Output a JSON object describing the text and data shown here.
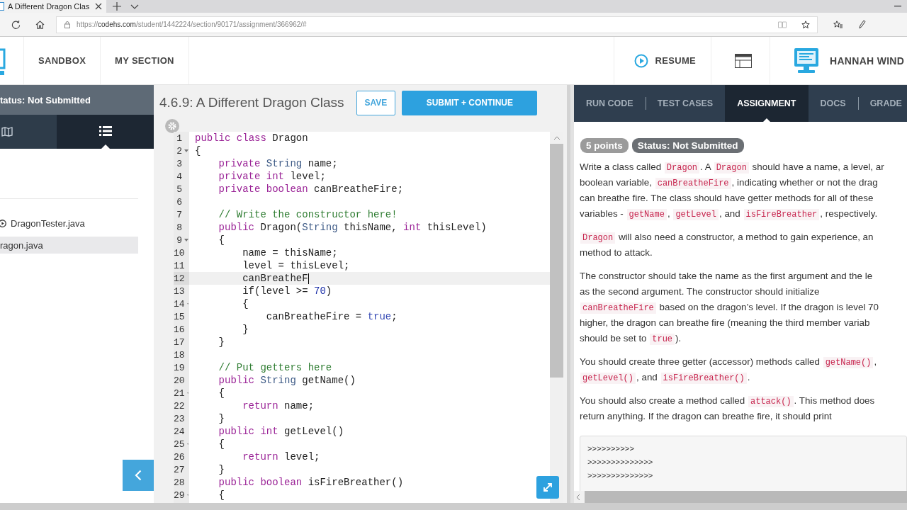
{
  "browser": {
    "tab_title": "A Different Dragon Clas",
    "url": {
      "scheme": "https://",
      "host": "codehs.com",
      "path": "/student/1442224/section/90171/assignment/366962/#"
    }
  },
  "header": {
    "nav": [
      {
        "label": "SANDBOX"
      },
      {
        "label": "MY SECTION"
      }
    ],
    "resume": "RESUME",
    "user": "HANNAH WIND"
  },
  "sidebar": {
    "status": "tatus: Not Submitted",
    "views": [
      {
        "kind": "map",
        "selected": false
      },
      {
        "kind": "list",
        "selected": true
      }
    ],
    "files": [
      {
        "name": "DragonTester.java",
        "kind": "runnable",
        "selected": false
      },
      {
        "name": "ragon.java",
        "kind": "plain",
        "selected": true
      }
    ]
  },
  "editor": {
    "title": "4.6.9: A Different Dragon Class",
    "save": "SAVE",
    "submit": "SUBMIT + CONTINUE",
    "lines": [
      {
        "number": "1",
        "fold": false,
        "active": false,
        "tokens": [
          {
            "kind": "keyword",
            "text": "public"
          },
          {
            "kind": "keyword",
            "text": " class"
          },
          {
            "kind": "plain",
            "text": " Dragon"
          }
        ]
      },
      {
        "number": "2",
        "fold": true,
        "active": false,
        "tokens": [
          {
            "kind": "plain",
            "text": "{"
          }
        ]
      },
      {
        "number": "3",
        "fold": false,
        "active": false,
        "tokens": [
          {
            "kind": "keyword",
            "text": "    private"
          },
          {
            "kind": "type",
            "text": " String"
          },
          {
            "kind": "plain",
            "text": " name;"
          }
        ]
      },
      {
        "number": "4",
        "fold": false,
        "active": false,
        "tokens": [
          {
            "kind": "keyword",
            "text": "    private int"
          },
          {
            "kind": "plain",
            "text": " level;"
          }
        ]
      },
      {
        "number": "5",
        "fold": false,
        "active": false,
        "tokens": [
          {
            "kind": "keyword",
            "text": "    private boolean"
          },
          {
            "kind": "plain",
            "text": " canBreatheFire;"
          }
        ]
      },
      {
        "number": "6",
        "fold": false,
        "active": false
      },
      {
        "number": "7",
        "fold": false,
        "active": false,
        "tokens": [
          {
            "kind": "comment",
            "text": "    // Write the constructor here!"
          }
        ]
      },
      {
        "number": "8",
        "fold": false,
        "active": false,
        "tokens": [
          {
            "kind": "keyword",
            "text": "    public"
          },
          {
            "kind": "plain",
            "text": " Dragon("
          },
          {
            "kind": "type",
            "text": "String"
          },
          {
            "kind": "plain",
            "text": " thisName, "
          },
          {
            "kind": "keyword",
            "text": "int"
          },
          {
            "kind": "plain",
            "text": " thisLevel)"
          }
        ]
      },
      {
        "number": "9",
        "fold": true,
        "active": false,
        "tokens": [
          {
            "kind": "plain",
            "text": "    {"
          }
        ]
      },
      {
        "number": "10",
        "fold": false,
        "active": false,
        "tokens": [
          {
            "kind": "plain",
            "text": "        name = thisName;"
          }
        ]
      },
      {
        "number": "11",
        "fold": false,
        "active": false,
        "tokens": [
          {
            "kind": "plain",
            "text": "        level = thisLevel;"
          }
        ]
      },
      {
        "number": "12",
        "fold": false,
        "active": true,
        "tokens": [
          {
            "kind": "plain",
            "text": "        canBreatheF"
          }
        ]
      },
      {
        "number": "13",
        "fold": false,
        "active": false,
        "tokens": [
          {
            "kind": "plain",
            "text": "        if(level >= "
          },
          {
            "kind": "number",
            "text": "70"
          },
          {
            "kind": "plain",
            "text": ")"
          }
        ]
      },
      {
        "number": "14",
        "fold": true,
        "active": false,
        "tokens": [
          {
            "kind": "plain",
            "text": "        {"
          }
        ]
      },
      {
        "number": "15",
        "fold": false,
        "active": false,
        "tokens": [
          {
            "kind": "plain",
            "text": "            canBreatheFire = "
          },
          {
            "kind": "literal",
            "text": "true"
          },
          {
            "kind": "plain",
            "text": ";"
          }
        ]
      },
      {
        "number": "16",
        "fold": false,
        "active": false,
        "tokens": [
          {
            "kind": "plain",
            "text": "        }"
          }
        ]
      },
      {
        "number": "17",
        "fold": false,
        "active": false,
        "tokens": [
          {
            "kind": "plain",
            "text": "    }"
          }
        ]
      },
      {
        "number": "18",
        "fold": false,
        "active": false
      },
      {
        "number": "19",
        "fold": false,
        "active": false,
        "tokens": [
          {
            "kind": "comment",
            "text": "    // Put getters here"
          }
        ]
      },
      {
        "number": "20",
        "fold": false,
        "active": false,
        "tokens": [
          {
            "kind": "keyword",
            "text": "    public"
          },
          {
            "kind": "type",
            "text": " String"
          },
          {
            "kind": "plain",
            "text": " getName()"
          }
        ]
      },
      {
        "number": "21",
        "fold": true,
        "active": false,
        "tokens": [
          {
            "kind": "plain",
            "text": "    {"
          }
        ]
      },
      {
        "number": "22",
        "fold": false,
        "active": false,
        "tokens": [
          {
            "kind": "keyword",
            "text": "        return"
          },
          {
            "kind": "plain",
            "text": " name;"
          }
        ]
      },
      {
        "number": "23",
        "fold": false,
        "active": false,
        "tokens": [
          {
            "kind": "plain",
            "text": "    }"
          }
        ]
      },
      {
        "number": "24",
        "fold": false,
        "active": false,
        "tokens": [
          {
            "kind": "keyword",
            "text": "    public int"
          },
          {
            "kind": "plain",
            "text": " getLevel()"
          }
        ]
      },
      {
        "number": "25",
        "fold": true,
        "active": false,
        "tokens": [
          {
            "kind": "plain",
            "text": "    {"
          }
        ]
      },
      {
        "number": "26",
        "fold": false,
        "active": false,
        "tokens": [
          {
            "kind": "keyword",
            "text": "        return"
          },
          {
            "kind": "plain",
            "text": " level;"
          }
        ]
      },
      {
        "number": "27",
        "fold": false,
        "active": false,
        "tokens": [
          {
            "kind": "plain",
            "text": "    }"
          }
        ]
      },
      {
        "number": "28",
        "fold": false,
        "active": false,
        "tokens": [
          {
            "kind": "keyword",
            "text": "    public boolean"
          },
          {
            "kind": "plain",
            "text": " isFireBreather()"
          }
        ]
      },
      {
        "number": "29",
        "fold": true,
        "active": false,
        "tokens": [
          {
            "kind": "plain",
            "text": "    {"
          }
        ]
      }
    ]
  },
  "panel": {
    "tabs": [
      {
        "label": "RUN CODE",
        "selected": false
      },
      {
        "label": "TEST CASES",
        "selected": false
      },
      {
        "label": "ASSIGNMENT",
        "selected": true
      },
      {
        "label": "DOCS",
        "selected": false
      },
      {
        "label": "GRADE",
        "selected": false
      }
    ],
    "badges": [
      {
        "text": "5 points",
        "color": "#9b9b9b"
      },
      {
        "text": "Status: Not Submitted",
        "color": "#6b6f74"
      }
    ],
    "paragraphs": [
      {
        "lines": [
          [
            {
              "kind": "text",
              "text": "Write a class called "
            },
            {
              "kind": "code",
              "text": "Dragon"
            },
            {
              "kind": "text",
              "text": ". A "
            },
            {
              "kind": "code",
              "text": "Dragon"
            },
            {
              "kind": "text",
              "text": " should have a name, a level, ar"
            }
          ],
          [
            {
              "kind": "text",
              "text": "boolean variable, "
            },
            {
              "kind": "code",
              "text": "canBreatheFire"
            },
            {
              "kind": "text",
              "text": ", indicating whether or not the drag"
            }
          ],
          [
            {
              "kind": "text",
              "text": "can breathe fire. The class should have getter methods for all of these"
            }
          ],
          [
            {
              "kind": "text",
              "text": "variables - "
            },
            {
              "kind": "code",
              "text": "getName"
            },
            {
              "kind": "text",
              "text": ", "
            },
            {
              "kind": "code",
              "text": "getLevel"
            },
            {
              "kind": "text",
              "text": ", and "
            },
            {
              "kind": "code",
              "text": "isFireBreather"
            },
            {
              "kind": "text",
              "text": ", respectively."
            }
          ]
        ]
      },
      {
        "lines": [
          [
            {
              "kind": "code",
              "text": "Dragon"
            },
            {
              "kind": "text",
              "text": " will also need a constructor, a method to gain experience, an"
            }
          ],
          [
            {
              "kind": "text",
              "text": "method to attack."
            }
          ]
        ]
      },
      {
        "lines": [
          [
            {
              "kind": "text",
              "text": "The constructor should take the name as the first argument and the le"
            }
          ],
          [
            {
              "kind": "text",
              "text": "as the second argument. The constructor should initialize"
            }
          ],
          [
            {
              "kind": "code",
              "text": "canBreatheFire"
            },
            {
              "kind": "text",
              "text": " based on the dragon’s level. If the dragon is level 70"
            }
          ],
          [
            {
              "kind": "text",
              "text": "higher, the dragon can breathe fire (meaning the third member variab"
            }
          ],
          [
            {
              "kind": "text",
              "text": "should be set to "
            },
            {
              "kind": "code",
              "text": "true"
            },
            {
              "kind": "text",
              "text": ")."
            }
          ]
        ]
      },
      {
        "lines": [
          [
            {
              "kind": "text",
              "text": "You should create three getter (accessor) methods called "
            },
            {
              "kind": "code",
              "text": "getName()"
            },
            {
              "kind": "text",
              "text": ","
            }
          ],
          [
            {
              "kind": "code",
              "text": "getLevel()"
            },
            {
              "kind": "text",
              "text": ", and "
            },
            {
              "kind": "code",
              "text": "isFireBreather()"
            },
            {
              "kind": "text",
              "text": "."
            }
          ]
        ]
      },
      {
        "lines": [
          [
            {
              "kind": "text",
              "text": "You should also create a method called "
            },
            {
              "kind": "code",
              "text": "attack()"
            },
            {
              "kind": "text",
              "text": ". This method does"
            }
          ],
          [
            {
              "kind": "text",
              "text": "return anything. If the dragon can breathe fire, it should print"
            }
          ]
        ]
      }
    ],
    "output": [
      ">>>>>>>>>>",
      ">>>>>>>>>>>>>>",
      ">>>>>>>>>>>>>>"
    ]
  }
}
